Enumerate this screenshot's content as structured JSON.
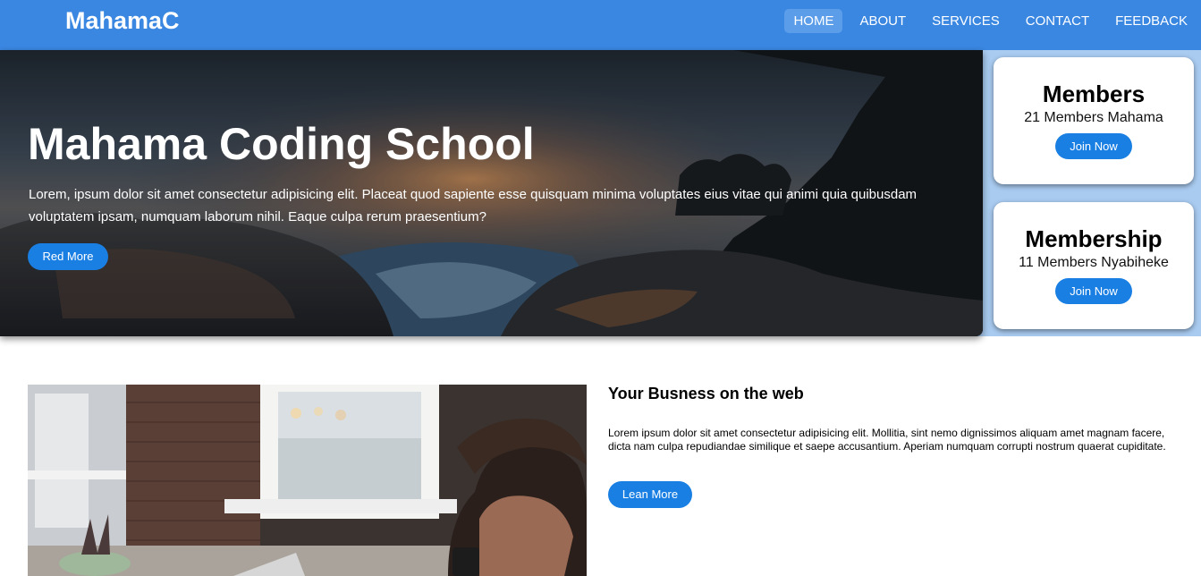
{
  "navbar": {
    "brand": "MahamaC",
    "links": [
      {
        "label": "HOME",
        "active": true
      },
      {
        "label": "ABOUT",
        "active": false
      },
      {
        "label": "SERVICES",
        "active": false
      },
      {
        "label": "CONTACT",
        "active": false
      },
      {
        "label": "FEEDBACK",
        "active": false
      }
    ]
  },
  "hero": {
    "title": "Mahama Coding School",
    "text": "Lorem, ipsum dolor sit amet consectetur adipisicing elit. Placeat quod sapiente esse quisquam minima voluptates eius vitae qui animi quia quibusdam voluptatem ipsam, numquam laborum nihil. Eaque culpa rerum praesentium?",
    "button_label": "Red More"
  },
  "cards": [
    {
      "title": "Members",
      "subtitle": "21 Members Mahama",
      "button_label": "Join Now"
    },
    {
      "title": "Membership",
      "subtitle": "11 Members Nyabiheke",
      "button_label": "Join Now"
    }
  ],
  "feature": {
    "title": "Your Busness on the web",
    "text": "Lorem ipsum dolor sit amet consectetur adipisicing elit. Mollitia, sint nemo dignissimos aliquam amet magnam facere, dicta nam culpa repudiandae similique et saepe accusantium. Aperiam numquam corrupti nostrum quaerat cupiditate.",
    "button_label": "Lean More"
  },
  "colors": {
    "navbar": "#3a87e2",
    "button": "#1a7fe3",
    "band": "#a9cbf0"
  }
}
